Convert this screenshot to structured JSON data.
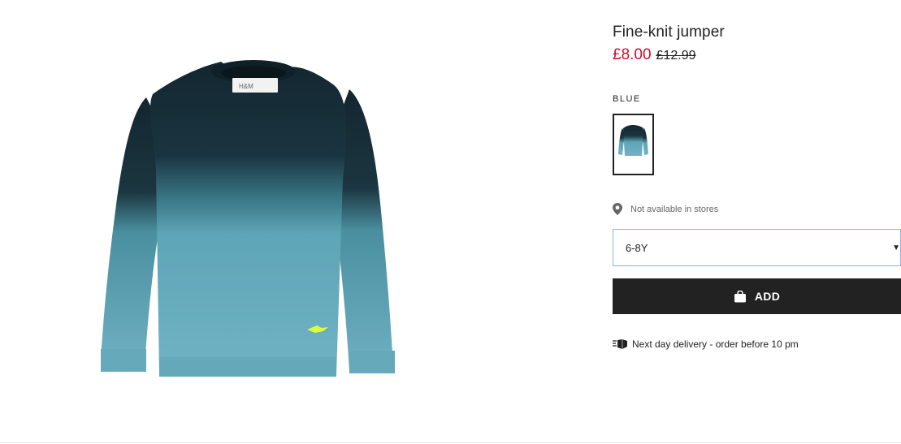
{
  "product": {
    "title": "Fine-knit jumper",
    "price_sale": "£8.00",
    "price_original": "£12.99",
    "color_label": "BLUE",
    "availability_text": "Not available in stores",
    "selected_size": "6-8Y",
    "add_label": "ADD",
    "delivery_text": "Next day delivery - order before 10 pm"
  },
  "colors": {
    "sale_price": "#c8102e",
    "button_bg": "#222222",
    "jumper_top": "#15282f",
    "jumper_bottom": "#69aec0",
    "select_border": "#8fb2e3"
  },
  "icons": {
    "availability": "location-pin-icon",
    "add": "shopping-bag-icon",
    "delivery": "delivery-truck-icon",
    "select": "caret-down-icon"
  }
}
